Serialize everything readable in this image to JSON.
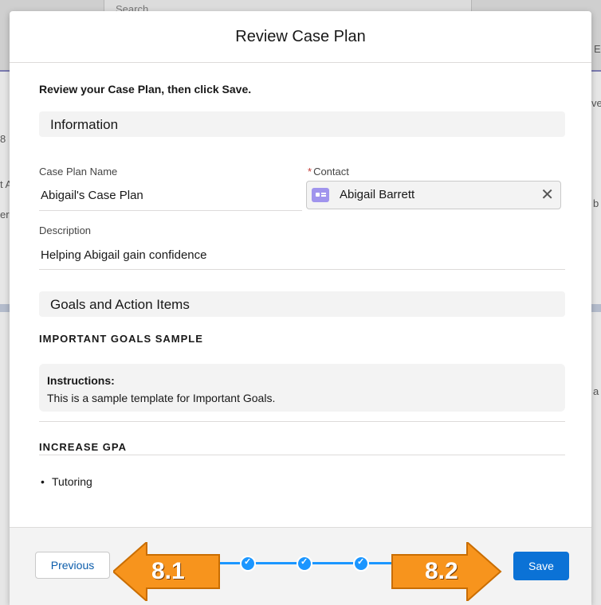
{
  "background": {
    "search_placeholder": "Search",
    "fragments": [
      "E",
      "ve",
      "8",
      "t A",
      "er",
      "b",
      "a"
    ]
  },
  "modal": {
    "title": "Review Case Plan",
    "intro": "Review your Case Plan, then click Save.",
    "sections": {
      "information": "Information",
      "goals": "Goals and Action Items"
    },
    "fields": {
      "case_plan_name": {
        "label": "Case Plan Name",
        "value": "Abigail's Case Plan"
      },
      "contact": {
        "label": "Contact",
        "required_mark": "*",
        "value": "Abigail Barrett"
      },
      "description": {
        "label": "Description",
        "value": "Helping Abigail gain confidence"
      }
    },
    "goals": [
      {
        "title": "IMPORTANT GOALS SAMPLE",
        "instructions_heading": "Instructions:",
        "instructions_text": "This is a sample template for Important Goals."
      },
      {
        "title": "INCREASE GPA",
        "action_items": [
          "Tutoring"
        ]
      }
    ]
  },
  "footer": {
    "previous_label": "Previous",
    "save_label": "Save"
  },
  "annotations": {
    "left": "8.1",
    "right": "8.2"
  },
  "colors": {
    "brand": "#0b72d6",
    "progress": "#1b96ff",
    "annotation": "#f7941d",
    "contact_icon": "#a094ed"
  },
  "icons": {
    "contact": "contact-card-icon",
    "clear": "close-icon",
    "step": "check-icon"
  }
}
